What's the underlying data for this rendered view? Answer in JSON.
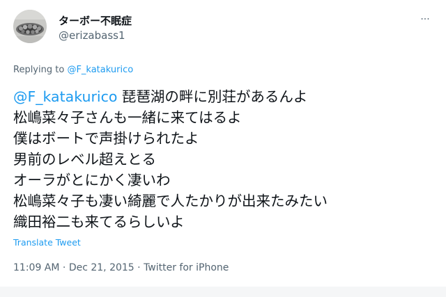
{
  "user": {
    "display_name": "ターボー不眠症",
    "handle": "@erizabass1",
    "avatar": "avatar-image"
  },
  "more_icon": "more-horizontal-icon",
  "more_glyph": "···",
  "reply_context": {
    "prefix": "Replying to ",
    "mention": "@F_katakurico"
  },
  "tweet": {
    "mention": "@F_katakurico",
    "first_line_rest": " 琵琶湖の畔に別荘があるんよ",
    "lines": [
      "松嶋菜々子さんも一緒に来てはるよ",
      "僕はボートで声掛けられたよ",
      "男前のレベル超えとる",
      "オーラがとにかく凄いわ",
      "松嶋菜々子も凄い綺麗で人たかりが出来たみたい",
      "織田裕二も来てるらしいよ"
    ]
  },
  "translate_label": "Translate Tweet",
  "meta": {
    "time": "11:09 AM",
    "separator": " · ",
    "date": "Dec 21, 2015",
    "source": "Twitter for iPhone"
  },
  "colors": {
    "text": "#0f1419",
    "secondary": "#536471",
    "accent": "#1d9bf0"
  }
}
